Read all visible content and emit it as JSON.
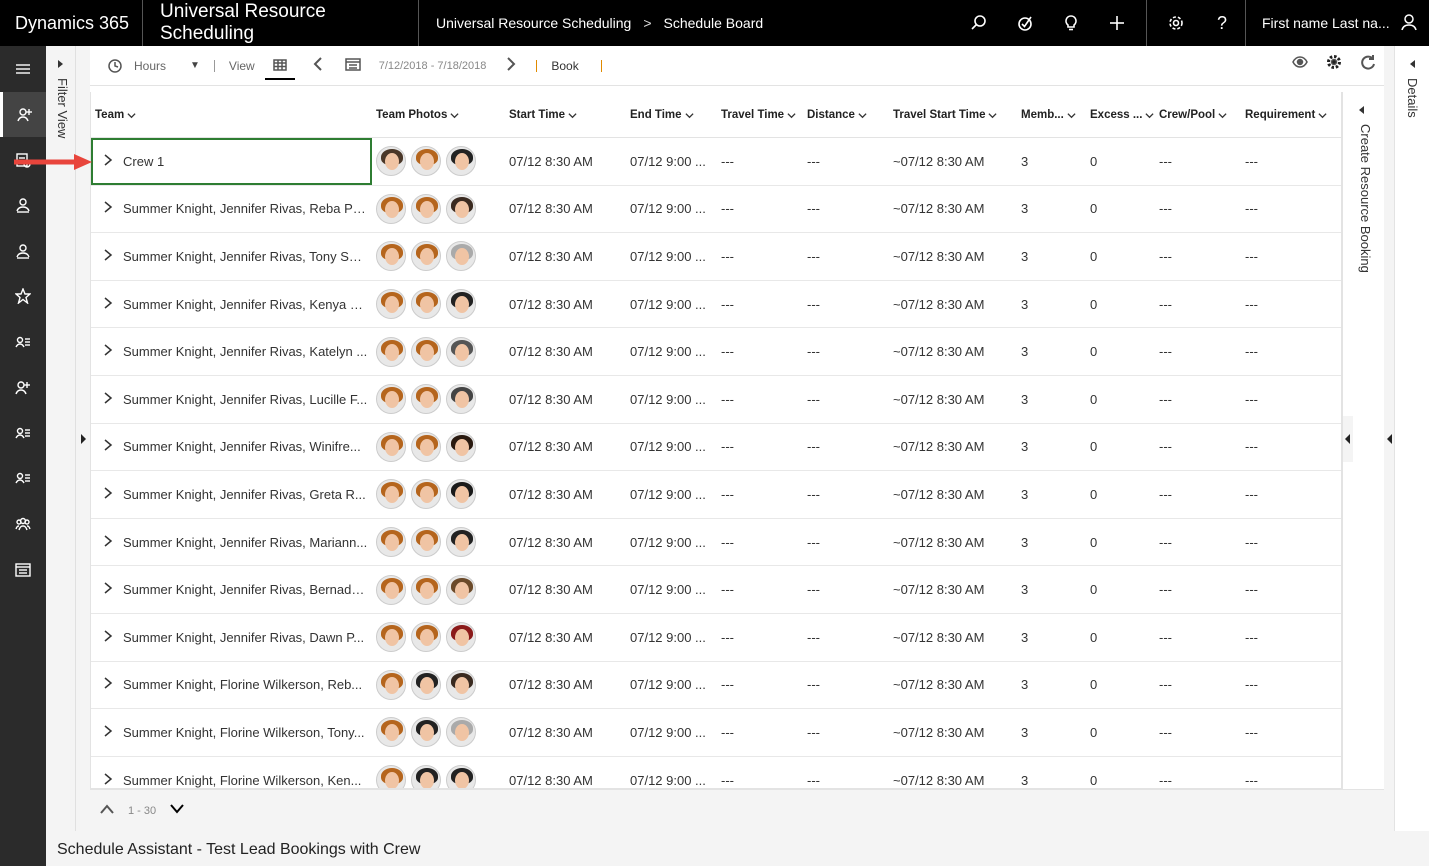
{
  "topbar": {
    "brand": "Dynamics 365",
    "app": "Universal Resource Scheduling",
    "breadcrumb_1": "Universal Resource Scheduling",
    "breadcrumb_sep": ">",
    "breadcrumb_2": "Schedule Board",
    "user": "First name Last na..."
  },
  "filter_view_label": "Filter View",
  "toolbar": {
    "hours_label": "Hours",
    "view_label": "View",
    "date_range": "7/12/2018 - 7/18/2018",
    "book_label": "Book"
  },
  "columns": {
    "team": "Team",
    "photos": "Team Photos",
    "start": "Start Time",
    "end": "End Time",
    "travel": "Travel Time",
    "distance": "Distance",
    "travel_start": "Travel Start Time",
    "members": "Memb...",
    "excess": "Excess ...",
    "crew": "Crew/Pool",
    "requirement": "Requirement"
  },
  "rows": [
    {
      "team": "Crew 1",
      "start": "07/12 8:30 AM",
      "end": "07/12 9:00 ...",
      "travel": "---",
      "distance": "---",
      "travel_start": "~07/12 8:30 AM",
      "members": "3",
      "excess": "0",
      "crew": "---",
      "requirement": "---"
    },
    {
      "team": "Summer Knight, Jennifer Rivas, Reba Po...",
      "start": "07/12 8:30 AM",
      "end": "07/12 9:00 ...",
      "travel": "---",
      "distance": "---",
      "travel_start": "~07/12 8:30 AM",
      "members": "3",
      "excess": "0",
      "crew": "---",
      "requirement": "---"
    },
    {
      "team": "Summer Knight, Jennifer Rivas, Tony Sel...",
      "start": "07/12 8:30 AM",
      "end": "07/12 9:00 ...",
      "travel": "---",
      "distance": "---",
      "travel_start": "~07/12 8:30 AM",
      "members": "3",
      "excess": "0",
      "crew": "---",
      "requirement": "---"
    },
    {
      "team": "Summer Knight, Jennifer Rivas, Kenya B...",
      "start": "07/12 8:30 AM",
      "end": "07/12 9:00 ...",
      "travel": "---",
      "distance": "---",
      "travel_start": "~07/12 8:30 AM",
      "members": "3",
      "excess": "0",
      "crew": "---",
      "requirement": "---"
    },
    {
      "team": "Summer Knight, Jennifer Rivas, Katelyn ...",
      "start": "07/12 8:30 AM",
      "end": "07/12 9:00 ...",
      "travel": "---",
      "distance": "---",
      "travel_start": "~07/12 8:30 AM",
      "members": "3",
      "excess": "0",
      "crew": "---",
      "requirement": "---"
    },
    {
      "team": "Summer Knight, Jennifer Rivas, Lucille F...",
      "start": "07/12 8:30 AM",
      "end": "07/12 9:00 ...",
      "travel": "---",
      "distance": "---",
      "travel_start": "~07/12 8:30 AM",
      "members": "3",
      "excess": "0",
      "crew": "---",
      "requirement": "---"
    },
    {
      "team": "Summer Knight, Jennifer Rivas, Winifre...",
      "start": "07/12 8:30 AM",
      "end": "07/12 9:00 ...",
      "travel": "---",
      "distance": "---",
      "travel_start": "~07/12 8:30 AM",
      "members": "3",
      "excess": "0",
      "crew": "---",
      "requirement": "---"
    },
    {
      "team": "Summer Knight, Jennifer Rivas, Greta R...",
      "start": "07/12 8:30 AM",
      "end": "07/12 9:00 ...",
      "travel": "---",
      "distance": "---",
      "travel_start": "~07/12 8:30 AM",
      "members": "3",
      "excess": "0",
      "crew": "---",
      "requirement": "---"
    },
    {
      "team": "Summer Knight, Jennifer Rivas, Mariann...",
      "start": "07/12 8:30 AM",
      "end": "07/12 9:00 ...",
      "travel": "---",
      "distance": "---",
      "travel_start": "~07/12 8:30 AM",
      "members": "3",
      "excess": "0",
      "crew": "---",
      "requirement": "---"
    },
    {
      "team": "Summer Knight, Jennifer Rivas, Bernade...",
      "start": "07/12 8:30 AM",
      "end": "07/12 9:00 ...",
      "travel": "---",
      "distance": "---",
      "travel_start": "~07/12 8:30 AM",
      "members": "3",
      "excess": "0",
      "crew": "---",
      "requirement": "---"
    },
    {
      "team": "Summer Knight, Jennifer Rivas, Dawn P...",
      "start": "07/12 8:30 AM",
      "end": "07/12 9:00 ...",
      "travel": "---",
      "distance": "---",
      "travel_start": "~07/12 8:30 AM",
      "members": "3",
      "excess": "0",
      "crew": "---",
      "requirement": "---"
    },
    {
      "team": "Summer Knight, Florine Wilkerson, Reb...",
      "start": "07/12 8:30 AM",
      "end": "07/12 9:00 ...",
      "travel": "---",
      "distance": "---",
      "travel_start": "~07/12 8:30 AM",
      "members": "3",
      "excess": "0",
      "crew": "---",
      "requirement": "---"
    },
    {
      "team": "Summer Knight, Florine Wilkerson, Tony...",
      "start": "07/12 8:30 AM",
      "end": "07/12 9:00 ...",
      "travel": "---",
      "distance": "---",
      "travel_start": "~07/12 8:30 AM",
      "members": "3",
      "excess": "0",
      "crew": "---",
      "requirement": "---"
    },
    {
      "team": "Summer Knight, Florine Wilkerson, Ken...",
      "start": "07/12 8:30 AM",
      "end": "07/12 9:00 ...",
      "travel": "---",
      "distance": "---",
      "travel_start": "~07/12 8:30 AM",
      "members": "3",
      "excess": "0",
      "crew": "---",
      "requirement": "---"
    }
  ],
  "create_booking_label": "Create Resource Booking",
  "details_label": "Details",
  "paging_label": "1 - 30",
  "status_text": "Schedule Assistant - Test Lead Bookings with Crew",
  "colors": {
    "accent": "#2e7d32",
    "topbar": "#000000",
    "nav": "#2b2b2b",
    "annotation": "#e8453c"
  },
  "nav_icons": [
    "menu-icon",
    "resources-icon",
    "bookings-icon",
    "requirements-icon",
    "crews-icon",
    "favorites-icon",
    "list-icon",
    "people-icon",
    "list-icon-2",
    "list-icon-3",
    "group-icon",
    "calendar-icon"
  ]
}
